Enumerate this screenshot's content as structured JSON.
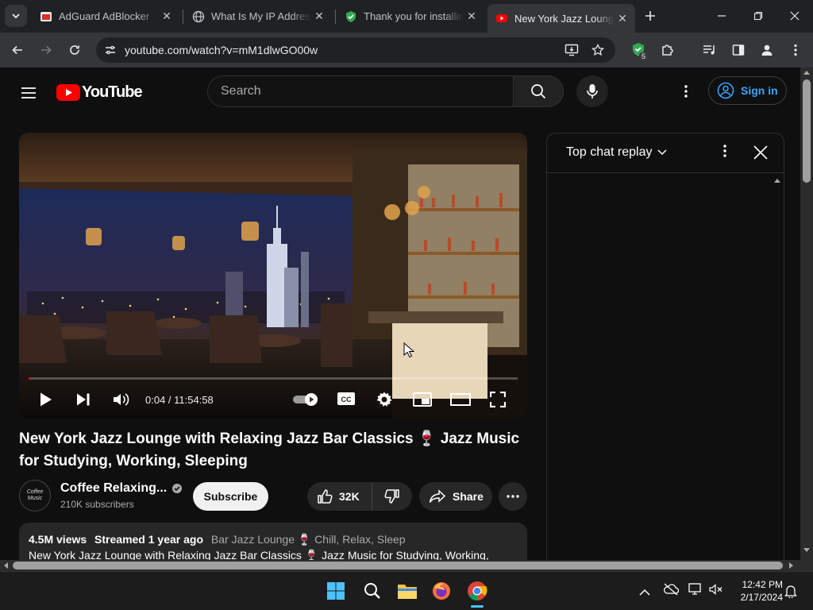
{
  "browser": {
    "tabs": [
      {
        "title": "AdGuard AdBlocker",
        "icon": "adguard-icon"
      },
      {
        "title": "What Is My IP Address",
        "icon": "globe-icon"
      },
      {
        "title": "Thank you for installing",
        "icon": "shield-check-icon"
      },
      {
        "title": "New York Jazz Lounge",
        "icon": "youtube-icon"
      }
    ],
    "url": "youtube.com/watch?v=mM1dlwGO00w",
    "extension_badge": "5"
  },
  "youtube": {
    "logo_text": "YouTube",
    "search_placeholder": "Search",
    "sign_in": "Sign in",
    "player": {
      "time": "0:04 / 11:54:58",
      "progress": 0.0001
    },
    "video_title": "New York Jazz Lounge with Relaxing Jazz Bar Classics 🍷 Jazz Music for Studying, Working, Sleeping",
    "channel": {
      "name": "Coffee Relaxing...",
      "subscribers": "210K subscribers",
      "avatar_text": "Coffee Music"
    },
    "subscribe": "Subscribe",
    "likes": "32K",
    "share": "Share",
    "description": {
      "views": "4.5M views",
      "streamed": "Streamed 1 year ago",
      "tags": "Bar Jazz Lounge 🍷 Chill, Relax, Sleep",
      "line2": "New York Jazz Lounge with Relaxing Jazz Bar Classics 🍷 Jazz Music for Studying, Working,"
    },
    "chat": {
      "title": "Top chat replay"
    }
  },
  "taskbar": {
    "time": "12:42 PM",
    "date": "2/17/2024"
  },
  "colors": {
    "accent": "#ff0000",
    "link": "#3ea6ff",
    "chrome_dark": "#202124"
  }
}
